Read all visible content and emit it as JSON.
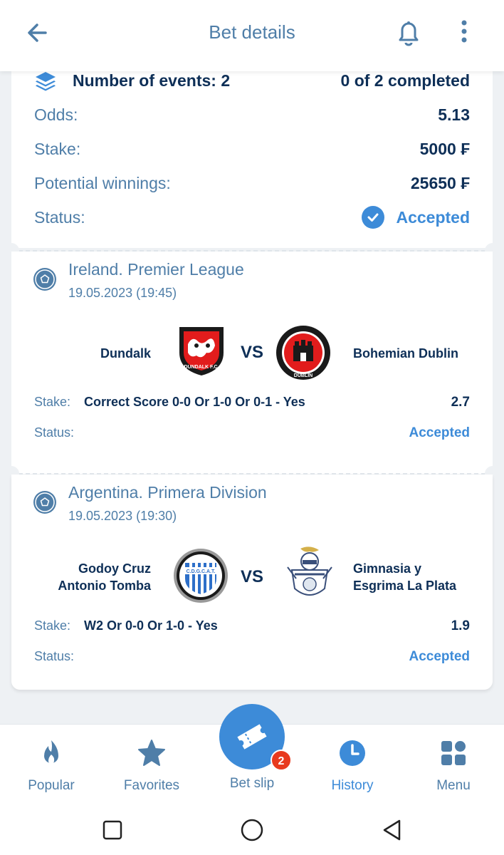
{
  "header": {
    "title": "Bet details"
  },
  "summary": {
    "events_label": "Number of events: 2",
    "completed": "0 of 2 completed",
    "odds_label": "Odds:",
    "odds_value": "5.13",
    "stake_label": "Stake:",
    "stake_value": "5000 ₣",
    "winnings_label": "Potential winnings:",
    "winnings_value": "25650 ₣",
    "status_label": "Status:",
    "status_value": "Accepted"
  },
  "events": [
    {
      "league": "Ireland. Premier League",
      "date": "19.05.2023 (19:45)",
      "home": "Dundalk",
      "away": "Bohemian Dublin",
      "vs": "VS",
      "stake_label": "Stake:",
      "stake": "Correct Score 0-0 Or 1-0 Or 0-1 - Yes",
      "odd": "2.7",
      "status_label": "Status:",
      "status": "Accepted",
      "home_logo_text": "DUNDALK F.C.",
      "away_logo_text": "DUBLIN"
    },
    {
      "league": "Argentina. Primera Division",
      "date": "19.05.2023 (19:30)",
      "home_line1": "Godoy Cruz",
      "home_line2": "Antonio Tomba",
      "away_line1": "Gimnasia y",
      "away_line2": "Esgrima La Plata",
      "vs": "VS",
      "stake_label": "Stake:",
      "stake": "W2 Or 0-0 Or 1-0 - Yes",
      "odd": "1.9",
      "status_label": "Status:",
      "status": "Accepted",
      "home_logo_text": "C.D.G.C.A.T."
    }
  ],
  "nav": {
    "popular": "Popular",
    "favorites": "Favorites",
    "betslip": "Bet slip",
    "history": "History",
    "menu": "Menu",
    "badge": "2"
  },
  "colors": {
    "accent": "#3d8bd8",
    "text_dark": "#0e2f57",
    "text_muted": "#4f7ea8",
    "badge": "#e83a1e"
  }
}
